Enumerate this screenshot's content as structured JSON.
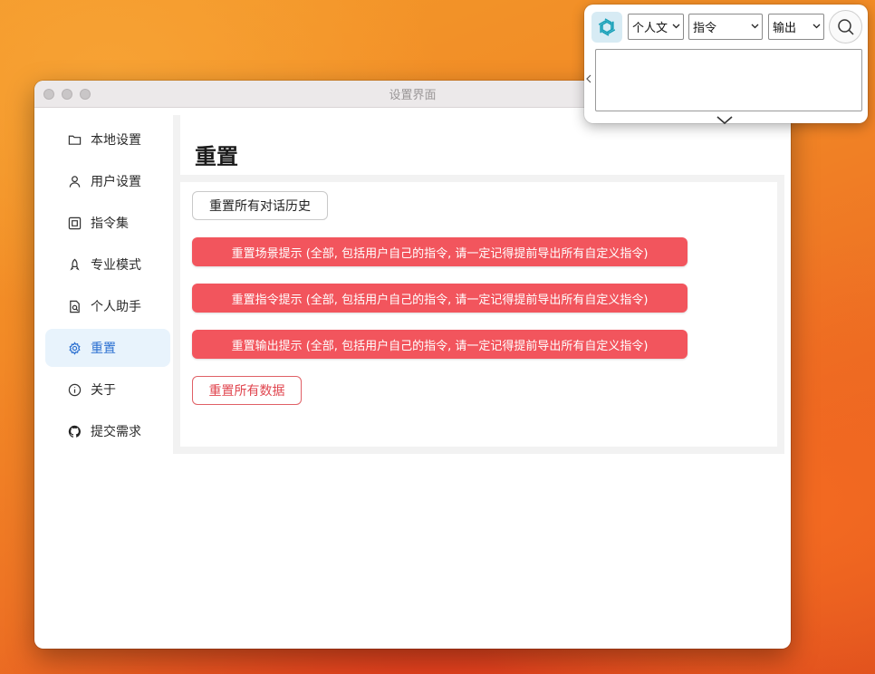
{
  "window": {
    "title": "设置界面"
  },
  "sidebar": {
    "items": [
      {
        "label": "本地设置",
        "icon": "folder-icon"
      },
      {
        "label": "用户设置",
        "icon": "user-icon"
      },
      {
        "label": "指令集",
        "icon": "command-icon"
      },
      {
        "label": "专业模式",
        "icon": "rocket-icon"
      },
      {
        "label": "个人助手",
        "icon": "document-search-icon"
      },
      {
        "label": "重置",
        "icon": "gear-icon",
        "active": true
      },
      {
        "label": "关于",
        "icon": "info-icon"
      },
      {
        "label": "提交需求",
        "icon": "github-icon"
      }
    ]
  },
  "main": {
    "title": "重置",
    "buttons": {
      "reset_history": "重置所有对话历史",
      "reset_scene": "重置场景提示 (全部, 包括用户自己的指令, 请一定记得提前导出所有自定义指令)",
      "reset_command": "重置指令提示 (全部, 包括用户自己的指令, 请一定记得提前导出所有自定义指令)",
      "reset_output": "重置输出提示 (全部, 包括用户自己的指令, 请一定记得提前导出所有自定义指令)",
      "reset_all": "重置所有数据"
    }
  },
  "popup": {
    "select_mode": "个人文",
    "select_command": "指令",
    "select_output": "输出",
    "textarea_value": ""
  },
  "colors": {
    "danger": "#f2555d",
    "active_bg": "#e8f3fc",
    "active_text": "#2a6fd0"
  }
}
